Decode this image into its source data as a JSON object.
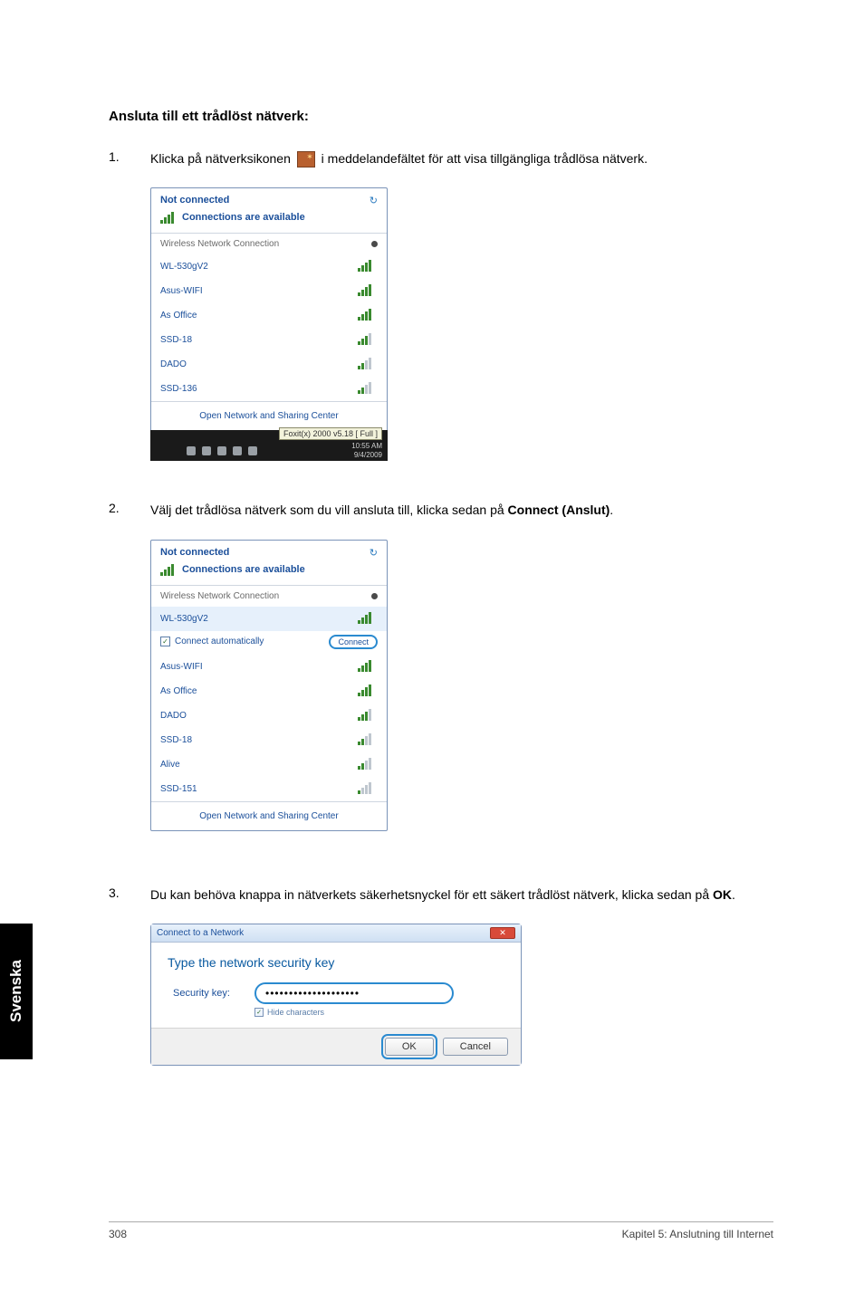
{
  "heading": "Ansluta till ett trådlöst nätverk:",
  "steps": {
    "1": {
      "num": "1.",
      "pre": "Klicka på nätverksikonen ",
      "post": " i meddelandefältet för att visa tillgängliga trådlösa nätverk."
    },
    "2": {
      "num": "2.",
      "text_pre": "Välj det trådlösa nätverk som du vill ansluta till, klicka sedan på ",
      "bold": "Connect (Anslut)",
      "text_post": "."
    },
    "3": {
      "num": "3.",
      "text_pre": "Du kan behöva knappa in nätverkets säkerhetsnyckel för ett säkert trådlöst nätverk, klicka sedan på ",
      "bold": "OK",
      "text_post": "."
    }
  },
  "popup1": {
    "title": "Not connected",
    "refresh_icon": "↻",
    "avail": "Connections are available",
    "section": "Wireless Network Connection",
    "items": [
      {
        "name": "WL-530gV2",
        "strength": 4
      },
      {
        "name": "Asus-WIFI",
        "strength": 4
      },
      {
        "name": "As Office",
        "strength": 4
      },
      {
        "name": "SSD-18",
        "strength": 3
      },
      {
        "name": "DADO",
        "strength": 2
      },
      {
        "name": "SSD-136",
        "strength": 2
      }
    ],
    "foot": "Open Network and Sharing Center",
    "tooltip": "Foxit(x) 2000 v5.18 [ Full ]",
    "time1": "10:55 AM",
    "time2": "9/4/2009"
  },
  "popup2": {
    "title": "Not connected",
    "refresh_icon": "↻",
    "avail": "Connections are available",
    "section": "Wireless Network Connection",
    "selected": "WL-530gV2",
    "auto_label": "Connect automatically",
    "auto_checked": "✓",
    "connect_btn": "Connect",
    "items": [
      {
        "name": "Asus-WIFI",
        "strength": 4
      },
      {
        "name": "As Office",
        "strength": 4
      },
      {
        "name": "DADO",
        "strength": 3
      },
      {
        "name": "SSD-18",
        "strength": 2
      },
      {
        "name": "Alive",
        "strength": 2
      },
      {
        "name": "SSD-151",
        "strength": 1
      }
    ],
    "foot": "Open Network and Sharing Center"
  },
  "dialog": {
    "titlebar": "Connect to a Network",
    "close": "✕",
    "heading": "Type the network security key",
    "label": "Security key:",
    "value": "••••••••••••••••••••",
    "hide_cb": "✓",
    "hide_label": "Hide characters",
    "ok": "OK",
    "cancel": "Cancel"
  },
  "side_tab": "Svenska",
  "footer": {
    "page": "308",
    "chapter": "Kapitel 5: Anslutning till Internet"
  }
}
